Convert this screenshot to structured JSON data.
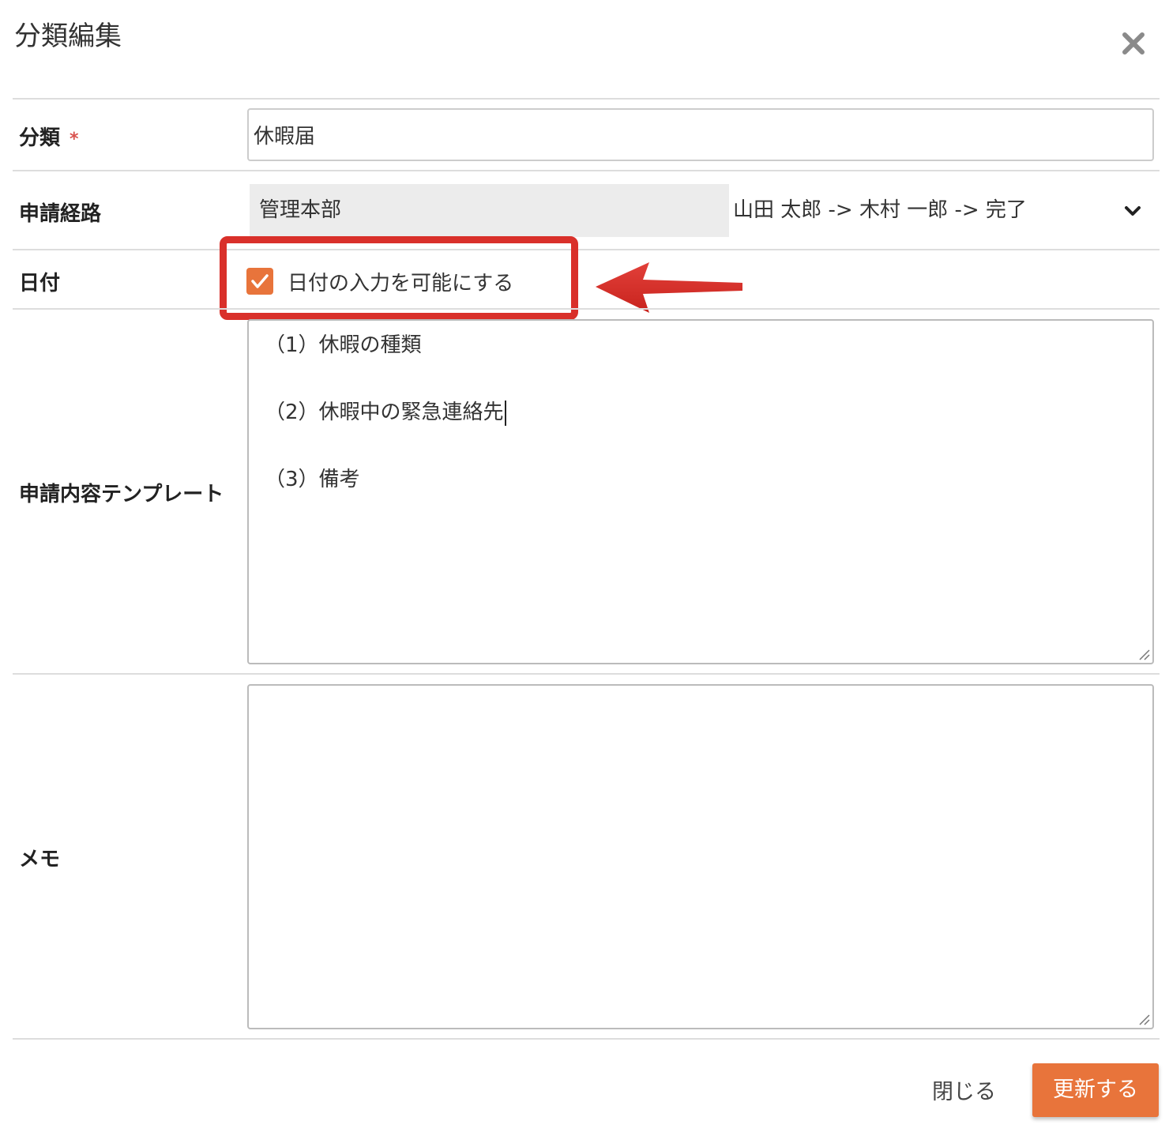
{
  "dialog": {
    "title": "分類編集"
  },
  "form": {
    "category": {
      "label": "分類",
      "required_mark": "*",
      "value": "休暇届"
    },
    "route": {
      "label": "申請経路",
      "group": "管理本部",
      "path": "山田 太郎 -> 木村 一郎 -> 完了"
    },
    "date": {
      "label": "日付",
      "checkbox_label": "日付の入力を可能にする",
      "checked": true
    },
    "template": {
      "label": "申請内容テンプレート",
      "lines": [
        "（1）休暇の種類",
        "（2）休暇中の緊急連絡先",
        "（3）備考"
      ]
    },
    "memo": {
      "label": "メモ",
      "value": ""
    }
  },
  "footer": {
    "close_label": "閉じる",
    "submit_label": "更新する"
  },
  "colors": {
    "accent": "#e8743b",
    "annotation": "#d9302a"
  }
}
